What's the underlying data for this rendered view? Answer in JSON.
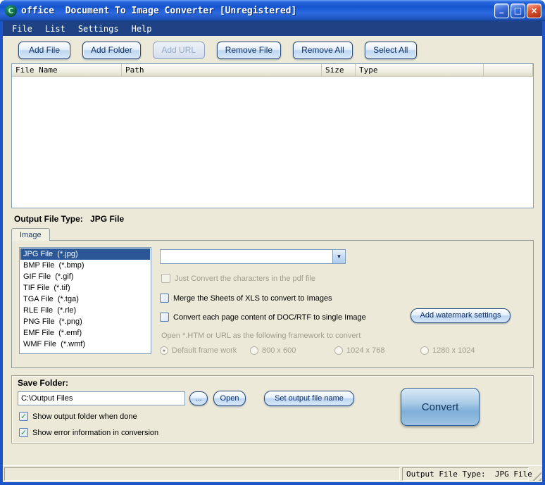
{
  "window": {
    "title": "office  Document To Image Converter [Unregistered]",
    "icon_letter": "C",
    "controls": {
      "minimize": "_",
      "maximize": "□",
      "close": "×"
    }
  },
  "menu": {
    "items": [
      "File",
      "List",
      "Settings",
      "Help"
    ]
  },
  "toolbar": {
    "buttons": [
      {
        "label": "Add File",
        "enabled": true
      },
      {
        "label": "Add Folder",
        "enabled": true
      },
      {
        "label": "Add URL",
        "enabled": false
      },
      {
        "label": "Remove File",
        "enabled": true
      },
      {
        "label": "Remove All",
        "enabled": true
      },
      {
        "label": "Select All",
        "enabled": true
      }
    ]
  },
  "file_list": {
    "columns": [
      "File Name",
      "Path",
      "Size",
      "Type",
      ""
    ],
    "rows": []
  },
  "output_type": {
    "label": "Output File Type:",
    "value": "JPG File"
  },
  "tabs": [
    {
      "label": "Image"
    }
  ],
  "format_list": {
    "selected_index": 0,
    "items": [
      "JPG File  (*.jpg)",
      "BMP File  (*.bmp)",
      "GIF File  (*.gif)",
      "TIF File  (*.tif)",
      "TGA File  (*.tga)",
      "RLE File  (*.rle)",
      "PNG File  (*.png)",
      "EMF File  (*.emf)",
      "WMF File  (*.wmf)"
    ]
  },
  "options": {
    "combo_value": "",
    "checkboxes": [
      {
        "label": "Just Convert the characters in the pdf file",
        "checked": false,
        "enabled": false
      },
      {
        "label": "Merge the Sheets of XLS to convert to Images",
        "checked": false,
        "enabled": true
      },
      {
        "label": "Convert each page content of DOC/RTF to single Image",
        "checked": false,
        "enabled": true
      }
    ],
    "watermark_button": "Add watermark settings",
    "framework_label": "Open *.HTM or URL as the following framework to convert",
    "radios": [
      {
        "label": "Default frame work",
        "selected": true
      },
      {
        "label": "800 x 600",
        "selected": false
      },
      {
        "label": "1024 x 768",
        "selected": false
      },
      {
        "label": "1280 x 1024",
        "selected": false
      }
    ]
  },
  "save_folder": {
    "group_label": "Save Folder:",
    "path_value": "C:\\Output Files",
    "browse_button": "...",
    "open_button": "Open",
    "set_name_button": "Set output file name",
    "convert_button": "Convert",
    "checkboxes": [
      {
        "label": "Show output folder when done",
        "checked": true
      },
      {
        "label": "Show error information in conversion",
        "checked": true
      }
    ]
  },
  "statusbar": {
    "right_text": "Output File Type:  JPG File"
  },
  "icons": {
    "check": "✓",
    "radio_dot": "●",
    "dropdown_arrow": "▼"
  }
}
